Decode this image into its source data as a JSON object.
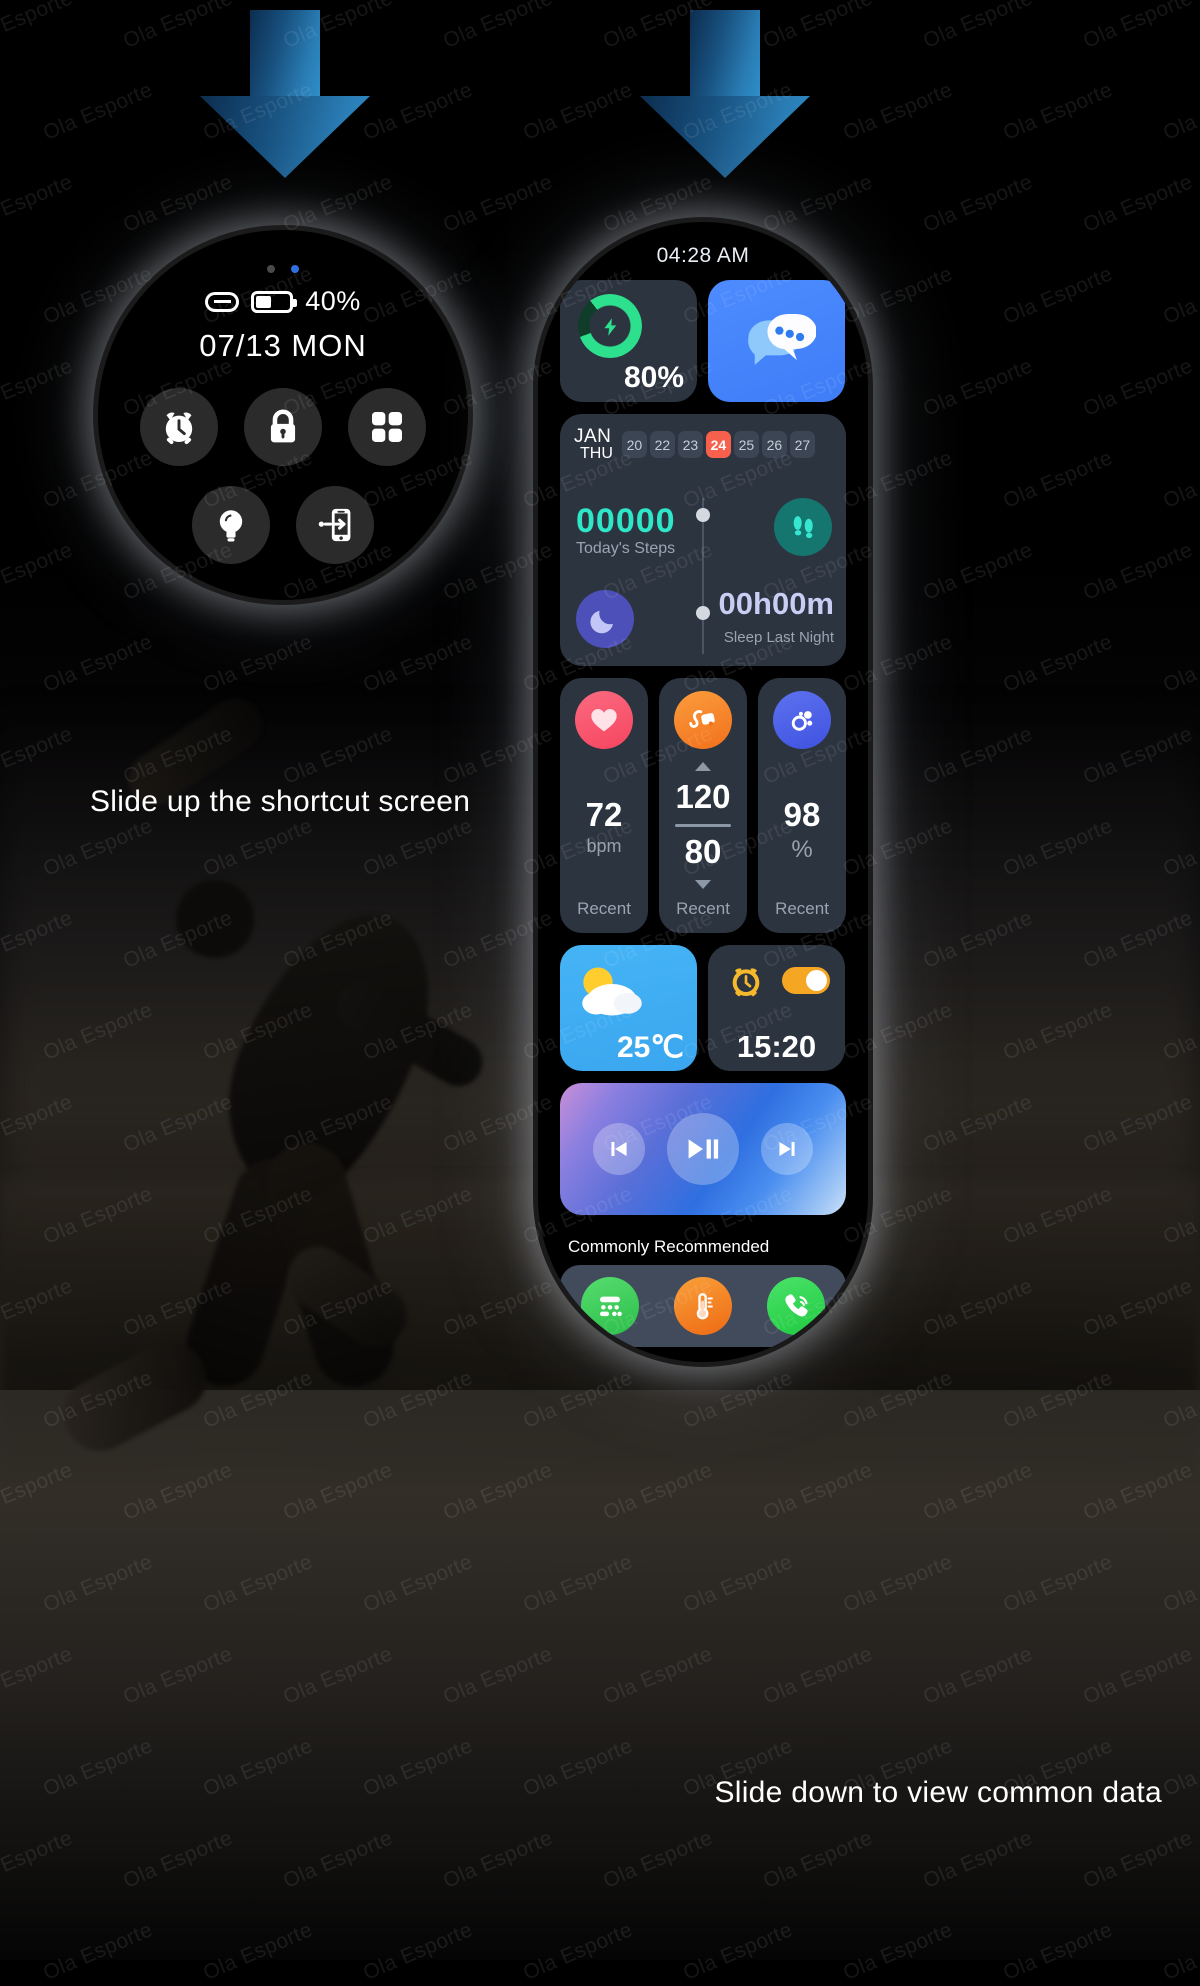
{
  "captions": {
    "left": "Slide up the shortcut screen",
    "right": "Slide down to view common data"
  },
  "watermark": {
    "text": "Ola Esporte"
  },
  "round_watch": {
    "status": {
      "battery_percent": "40%",
      "battery_level": 40,
      "link_icon": "link-icon",
      "battery_icon": "battery-icon"
    },
    "date": "07/13 MON",
    "page_dots": [
      {
        "active": false
      },
      {
        "active": true
      }
    ],
    "shortcuts": [
      {
        "name": "alarm-icon",
        "label": "Alarm"
      },
      {
        "name": "lock-icon",
        "label": "Lock"
      },
      {
        "name": "apps-grid-icon",
        "label": "Apps"
      },
      {
        "name": "lightbulb-icon",
        "label": "Flashlight"
      },
      {
        "name": "find-phone-icon",
        "label": "Find Phone"
      }
    ]
  },
  "rect_watch": {
    "clock": "04:28 AM",
    "battery_widget": {
      "percent": "80%",
      "value": 80,
      "icon": "charging-bolt-icon",
      "ring_color": "#2de08d"
    },
    "message_widget": {
      "icon": "message-bubble-icon",
      "bg_color": "#4d8bff"
    },
    "activity": {
      "month": "JAN",
      "weekday": "THU",
      "days": [
        "20",
        "22",
        "23",
        "24",
        "25",
        "26",
        "27"
      ],
      "selected_day": "24",
      "selected_color": "#f8604e",
      "steps_value": "00000",
      "steps_label": "Today's Steps",
      "steps_icon": "footsteps-icon",
      "sleep_value": "00h00m",
      "sleep_label": "Sleep Last Night",
      "sleep_icon": "moon-sleep-icon"
    },
    "health": [
      {
        "icon": "heart-icon",
        "icon_color": "#f8566e",
        "value": "72",
        "unit": "bpm",
        "status": "Recent"
      },
      {
        "icon": "blood-pressure-cuff-icon",
        "icon_color": "#f7862a",
        "systolic": "120",
        "diastolic": "80",
        "status": "Recent"
      },
      {
        "icon": "spo2-icon",
        "icon_color": "#4a63e8",
        "value": "98",
        "unit": "%",
        "status": "Recent"
      }
    ],
    "weather": {
      "temperature": "25℃",
      "icon": "sun-cloud-icon",
      "bg_color": "#45b4f5"
    },
    "alarm": {
      "time": "15:20",
      "icon": "alarm-clock-icon",
      "toggle_on": true,
      "toggle_color": "#f5a623"
    },
    "music": {
      "prev_icon": "previous-track-icon",
      "play_icon": "play-pause-icon",
      "next_icon": "next-track-icon"
    },
    "recommended": {
      "title": "Commonly Recommended",
      "apps": [
        {
          "icon": "calculator-icon",
          "color": "#3ecf5b"
        },
        {
          "icon": "thermometer-icon",
          "color": "#f3821f"
        },
        {
          "icon": "phone-icon",
          "color": "#2fd14f"
        }
      ]
    }
  }
}
